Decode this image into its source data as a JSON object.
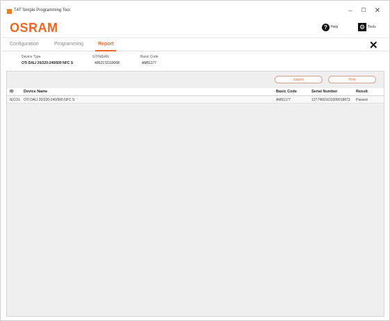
{
  "window": {
    "title": "T4T Simple Programming Tool",
    "min_glyph": "–",
    "max_glyph": "☐",
    "close_glyph": "✕"
  },
  "header": {
    "logo": "OSRAM",
    "help_label": "Help",
    "tools_label": "Tools",
    "help_glyph": "?",
    "tools_glyph": "⚙"
  },
  "tabs": {
    "items": [
      {
        "label": "Configuration"
      },
      {
        "label": "Programming"
      },
      {
        "label": "Report"
      }
    ],
    "active": "Report",
    "close_glyph": "✕"
  },
  "device": {
    "type_label": "Device Type",
    "type_value": "OTi DALI 20/220-240/500 NFC S",
    "gtin_label": "GTIN/EAN",
    "gtin_value": "4062172110068",
    "code_label": "Basic Code",
    "code_value": "AM51177"
  },
  "report": {
    "export_label": "Export",
    "print_label": "Print",
    "columns": [
      "ID",
      "Device Name",
      "Basic Code",
      "Serial Number",
      "Result"
    ],
    "rows": [
      {
        "id": "IECO1",
        "name": "OTi DALI 20/220-240/500 NFC S",
        "code": "AM51177",
        "serial": "12774601631008018873",
        "result": "Passed"
      }
    ]
  },
  "colors": {
    "accent": "#f26522",
    "app_icon": "#f07d1a"
  }
}
